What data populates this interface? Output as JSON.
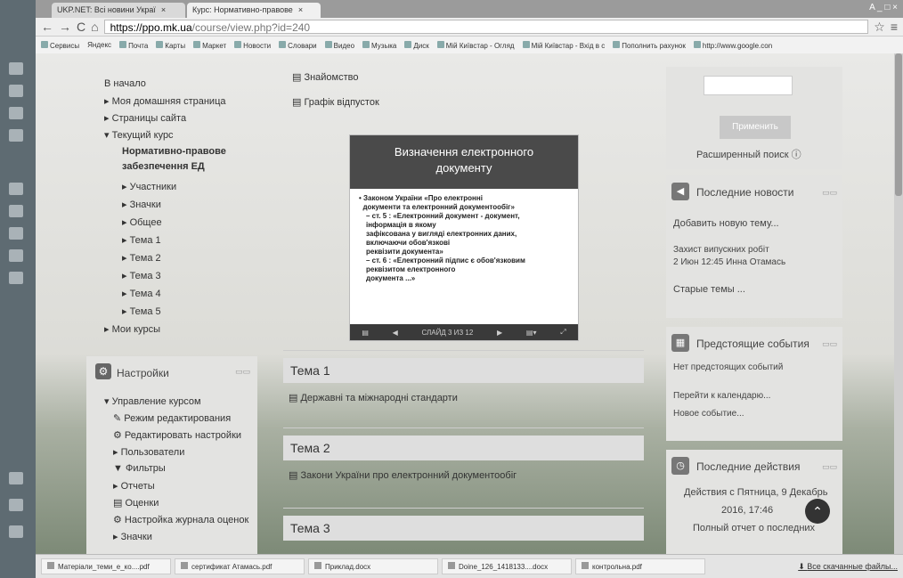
{
  "browser": {
    "tabs": [
      {
        "label": "UKP.NET: Всі новини Украї"
      },
      {
        "label": "Курс: Нормативно-правове"
      }
    ],
    "window_controls": "A _ □ ×",
    "url_host": "https://ppo.mk.ua",
    "url_path": "/course/view.php?id=240",
    "bookmarks": [
      "Сервисы",
      "Яндекс",
      "Почта",
      "Карты",
      "Маркет",
      "Новости",
      "Словари",
      "Видео",
      "Музыка",
      "Диск",
      "Мій Київстар - Огляд",
      "Мій Київстар - Вхід в с",
      "Пополнить рахунок",
      "http://www.google.con"
    ]
  },
  "nav": {
    "items": [
      {
        "label": "В начало"
      },
      {
        "label": "Моя домашняя страница"
      },
      {
        "label": "Страницы сайта"
      },
      {
        "label": "Текущий курс"
      },
      {
        "label": "Нормативно-правове"
      },
      {
        "label": "забезпечення ЕД"
      },
      {
        "label": "Участники"
      },
      {
        "label": "Значки"
      },
      {
        "label": "Общее"
      },
      {
        "label": "Тема 1"
      },
      {
        "label": "Тема 2"
      },
      {
        "label": "Тема 3"
      },
      {
        "label": "Тема 4"
      },
      {
        "label": "Тема 5"
      },
      {
        "label": "Мои курсы"
      }
    ]
  },
  "settings": {
    "title": "Настройки",
    "items": [
      {
        "label": "Управление курсом"
      },
      {
        "label": "Режим редактирования"
      },
      {
        "label": "Редактировать настройки"
      },
      {
        "label": "Пользователи"
      },
      {
        "label": "Фильтры"
      },
      {
        "label": "Отчеты"
      },
      {
        "label": "Оценки"
      },
      {
        "label": "Настройка журнала оценок"
      },
      {
        "label": "Значки"
      }
    ]
  },
  "center": {
    "link1": "Знайомство",
    "link2": "Графік відпусток",
    "slide": {
      "title1": "Визначення електронного",
      "title2": "документу",
      "b1": "Законом України «Про електронні",
      "b2": "документи та електронний документообіг»",
      "b3": "– ст. 5 : «Електронний документ - документ,",
      "b4": "інформація в якому",
      "b5": "зафіксована у вигляді електронних даних,",
      "b6": "включаючи обов'язкові",
      "b7": "реквізити документа»",
      "b8": "– ст. 6 : «Електронний підпис є обов'язковим",
      "b9": "реквізитом електронного",
      "b10": "документа ...»",
      "counter": "СЛАЙД 3 ИЗ 12"
    },
    "topics": [
      {
        "title": "Тема 1",
        "link": "Державні та міжнародні стандарти"
      },
      {
        "title": "Тема 2",
        "link": "Закони України про електронний документообіг"
      },
      {
        "title": "Тема 3",
        "link": ""
      }
    ]
  },
  "right": {
    "apply_label": "Применить",
    "adv_search": "Расширенный поиск",
    "news": {
      "title": "Последние новости",
      "add": "Добавить новую тему...",
      "item1": "Захист випускних робіт",
      "item1_meta": "2 Июн 12:45 Инна Отамась",
      "old": "Старые темы ..."
    },
    "events": {
      "title": "Предстоящие события",
      "none": "Нет предстоящих событий",
      "cal": "Перейти к календарю...",
      "new": "Новое событие..."
    },
    "actions": {
      "title": "Последние действия",
      "line1": "Действия с Пятница, 9 Декабрь",
      "line2": "2016, 17:46",
      "line3": "Полный отчет о последних"
    }
  },
  "downloads": {
    "items": [
      {
        "label": "Матеріали_теми_е_ко....pdf"
      },
      {
        "label": "сертификат Атамась.pdf"
      },
      {
        "label": "Приклад.docx"
      },
      {
        "label": "Doine_126_1418133....docx"
      },
      {
        "label": "контрольна.pdf"
      }
    ],
    "all": "Все скачанные файлы..."
  }
}
